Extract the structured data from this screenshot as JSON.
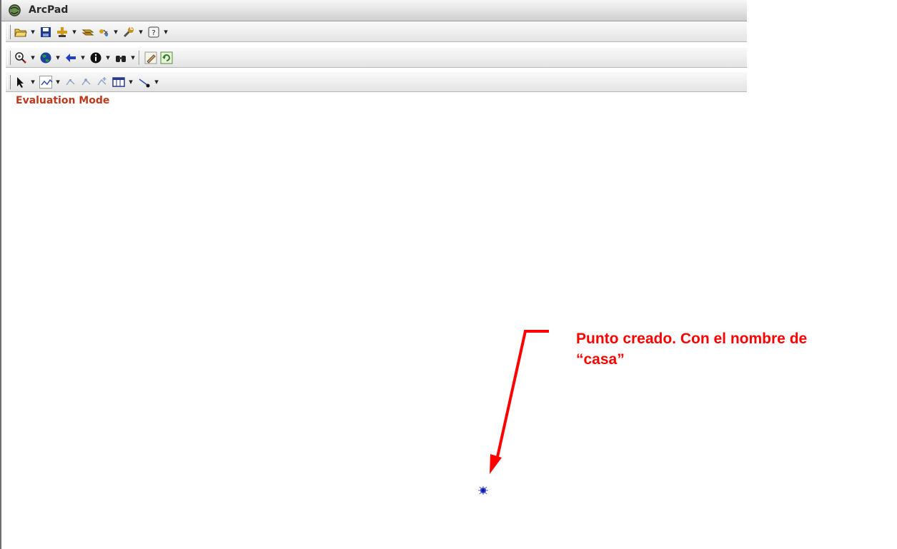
{
  "window": {
    "title": "ArcPad",
    "app_icon": "arcpad-globe-icon"
  },
  "toolbars": [
    {
      "name": "file-toolbar",
      "items": [
        "open-icon",
        "save-icon",
        "add-layer-icon",
        "layers-icon",
        "gps-icon",
        "tools-icon",
        "help-icon"
      ]
    },
    {
      "name": "navigation-toolbar",
      "items": [
        "zoom-in-icon",
        "globe-icon",
        "back-arrow-icon",
        "identify-icon",
        "find-icon",
        "edit-icon",
        "refresh-icon"
      ]
    },
    {
      "name": "editing-toolbar",
      "items": [
        "select-arrow-icon",
        "polyline-icon",
        "vertex-icon",
        "vertex-move-icon",
        "vertex-add-icon",
        "table-icon",
        "line-point-icon"
      ]
    }
  ],
  "map": {
    "watermark": "Evaluation Mode",
    "point_symbol": "point-symbol-icon"
  },
  "annotation": {
    "text_line1": "Punto creado. Con el nombre de",
    "text_line2": "“casa”",
    "color": "#ff0000"
  },
  "colors": {
    "watermark": "#c0391c",
    "annotation": "#ff0000",
    "point": "#1f2fbf"
  }
}
